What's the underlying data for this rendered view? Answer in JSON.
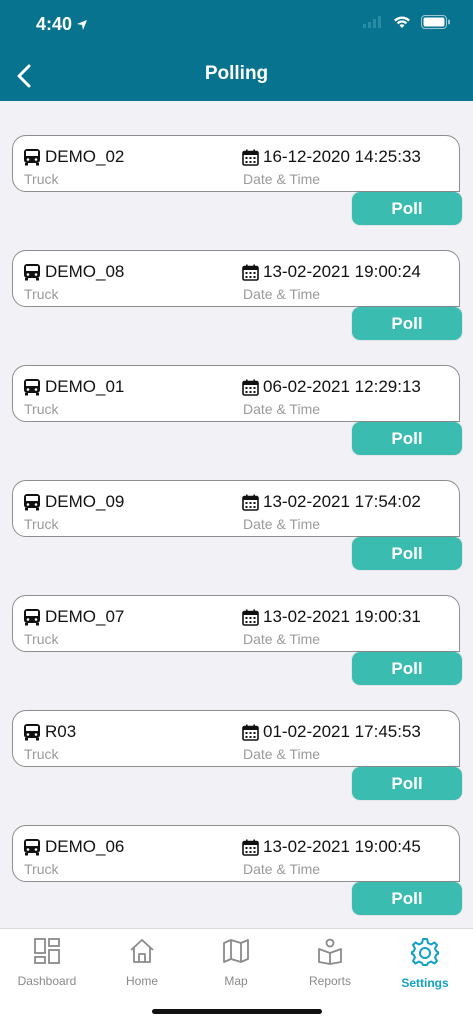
{
  "status": {
    "time": "4:40"
  },
  "header": {
    "title": "Polling"
  },
  "items": [
    {
      "truck": "DEMO_02",
      "truck_label": "Truck",
      "datetime": "16-12-2020 14:25:33",
      "datetime_label": "Date & Time",
      "poll": "Poll"
    },
    {
      "truck": "DEMO_08",
      "truck_label": "Truck",
      "datetime": "13-02-2021 19:00:24",
      "datetime_label": "Date & Time",
      "poll": "Poll"
    },
    {
      "truck": "DEMO_01",
      "truck_label": "Truck",
      "datetime": "06-02-2021 12:29:13",
      "datetime_label": "Date & Time",
      "poll": "Poll"
    },
    {
      "truck": "DEMO_09",
      "truck_label": "Truck",
      "datetime": "13-02-2021 17:54:02",
      "datetime_label": "Date & Time",
      "poll": "Poll"
    },
    {
      "truck": "DEMO_07",
      "truck_label": "Truck",
      "datetime": "13-02-2021 19:00:31",
      "datetime_label": "Date & Time",
      "poll": "Poll"
    },
    {
      "truck": "R03",
      "truck_label": "Truck",
      "datetime": "01-02-2021 17:45:53",
      "datetime_label": "Date & Time",
      "poll": "Poll"
    },
    {
      "truck": "DEMO_06",
      "truck_label": "Truck",
      "datetime": "13-02-2021 19:00:45",
      "datetime_label": "Date & Time",
      "poll": "Poll"
    }
  ],
  "tabs": [
    {
      "label": "Dashboard",
      "icon": "dashboard-icon",
      "active": false
    },
    {
      "label": "Home",
      "icon": "home-icon",
      "active": false
    },
    {
      "label": "Map",
      "icon": "map-icon",
      "active": false
    },
    {
      "label": "Reports",
      "icon": "reports-icon",
      "active": false
    },
    {
      "label": "Settings",
      "icon": "gear-icon",
      "active": true
    }
  ],
  "colors": {
    "header": "#08738f",
    "poll": "#3bbcb0",
    "active_tab": "#13a0c7"
  }
}
